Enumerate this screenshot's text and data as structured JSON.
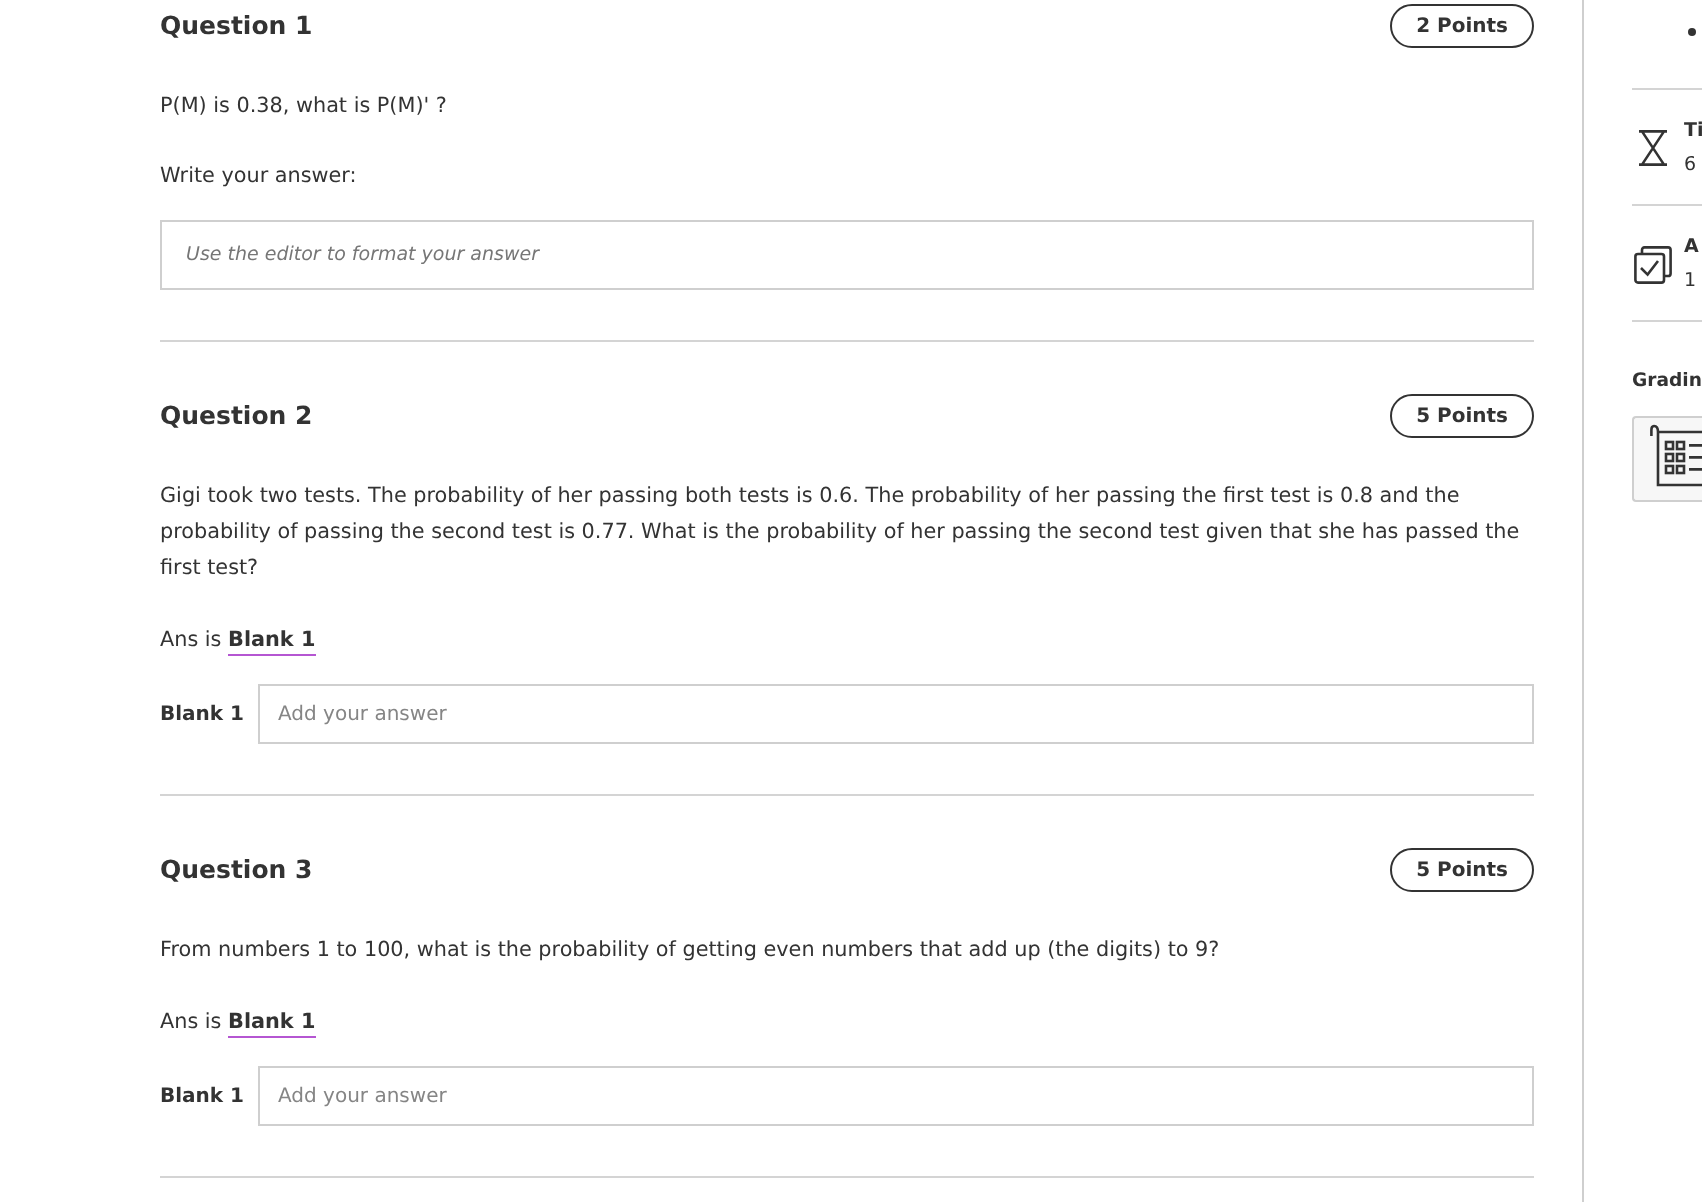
{
  "questions": [
    {
      "kind": "editor",
      "title": "Question 1",
      "points": "2 Points",
      "prompt": "P(M) is 0.38, what is P(M)' ?",
      "instruction": "Write your answer:",
      "editor": {
        "placeholder": "Use the editor to format your answer"
      }
    },
    {
      "kind": "blank",
      "title": "Question 2",
      "points": "5 Points",
      "prompt": "Gigi took two tests. The probability of her passing both tests is 0.6. The probability of her passing the first test is 0.8 and the probability of passing the second test is 0.77. What is the probability of her passing the second test given that she has passed the first test?",
      "answer_line": {
        "prefix": "Ans is",
        "blank": "Blank 1"
      },
      "blank_field": {
        "label": "Blank 1",
        "placeholder": "Add your answer"
      }
    },
    {
      "kind": "blank",
      "title": "Question 3",
      "points": "5 Points",
      "prompt": "From numbers 1 to 100, what is the probability of getting even numbers that add up (the digits) to 9?",
      "answer_line": {
        "prefix": "Ans is",
        "blank": "Blank 1"
      },
      "blank_field": {
        "label": "Blank 1",
        "placeholder": "Add your answer"
      }
    }
  ],
  "sidebar": {
    "details": [
      {
        "kind": "time",
        "label": "Ti",
        "value": "6"
      },
      {
        "kind": "attempts",
        "label": "A",
        "value": "1"
      }
    ],
    "grading": {
      "title": "Gradin"
    }
  }
}
